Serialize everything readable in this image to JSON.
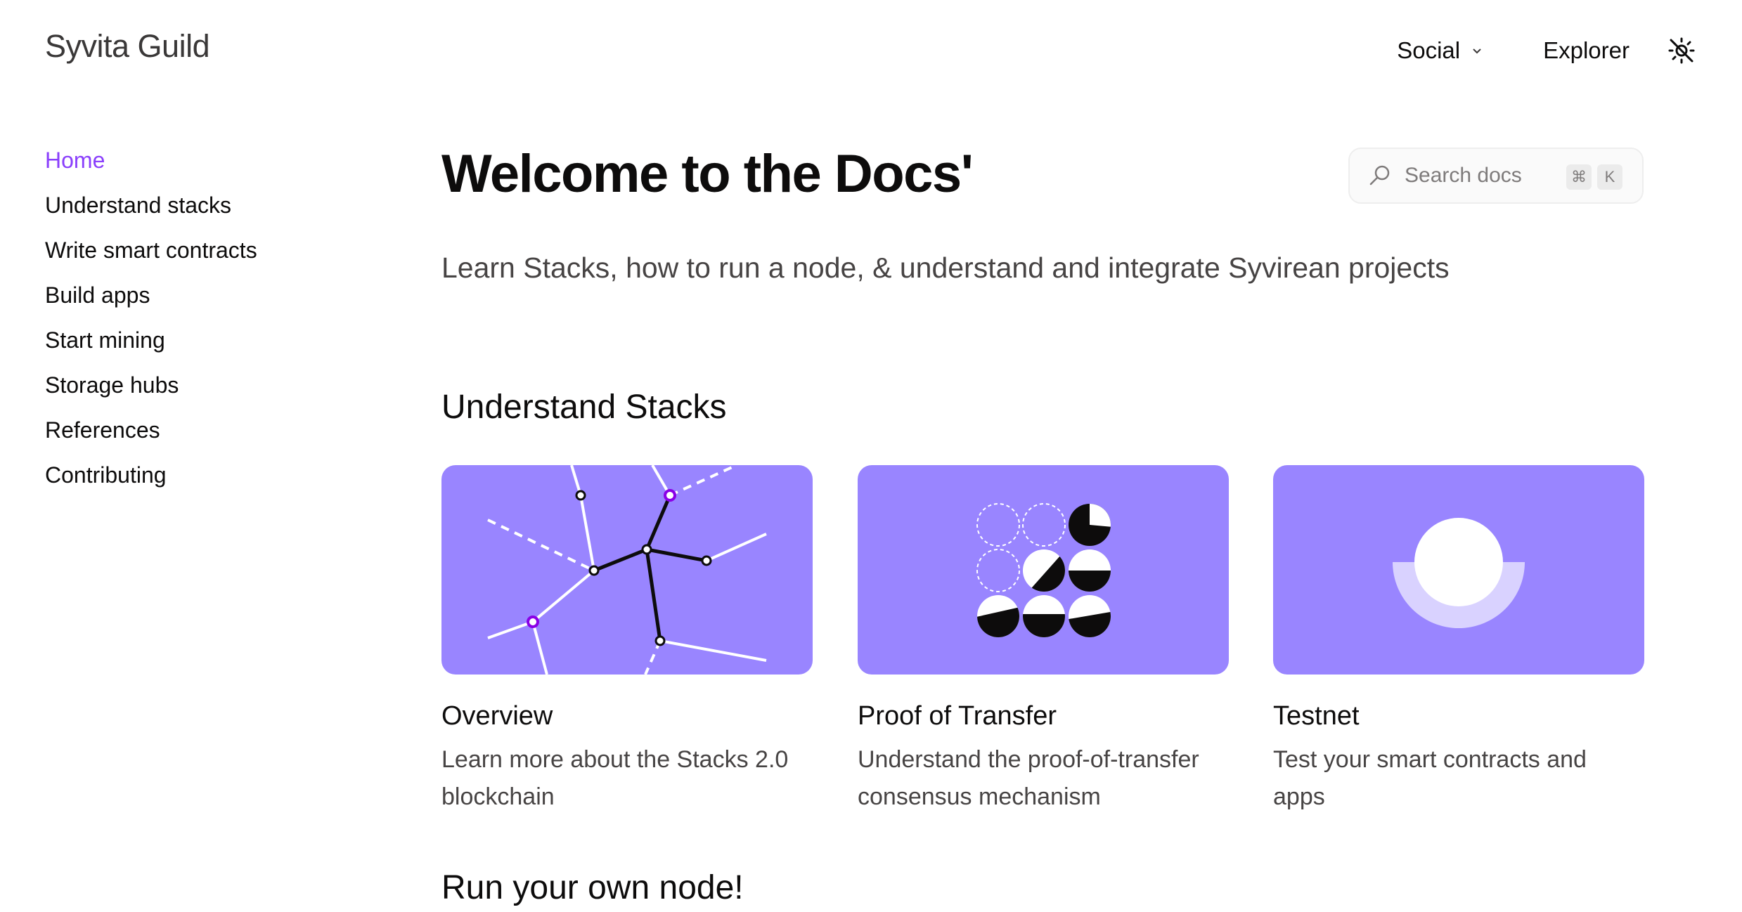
{
  "header": {
    "brand": "Syvita Guild",
    "nav": {
      "social_label": "Social",
      "explorer_label": "Explorer"
    },
    "icons": {
      "social_dropdown": "chevron-down-icon",
      "theme_toggle": "sun-off-icon"
    }
  },
  "sidebar": {
    "items": [
      {
        "label": "Home",
        "active": true
      },
      {
        "label": "Understand stacks"
      },
      {
        "label": "Write smart contracts"
      },
      {
        "label": "Build apps"
      },
      {
        "label": "Start mining"
      },
      {
        "label": "Storage hubs"
      },
      {
        "label": "References"
      },
      {
        "label": "Contributing"
      }
    ]
  },
  "main": {
    "title": "Welcome to the Docs'",
    "subtitle": "Learn Stacks, how to run a node, & understand and integrate Syvirean projects",
    "search": {
      "placeholder": "Search docs",
      "shortcut": [
        "⌘",
        "K"
      ],
      "icon": "search-icon"
    },
    "sections": [
      {
        "title": "Understand Stacks",
        "cards": [
          {
            "title": "Overview",
            "description": "Learn more about the Stacks 2.0 blockchain",
            "illustration": "network-graph"
          },
          {
            "title": "Proof of Transfer",
            "description": "Understand the proof-of-transfer consensus mechanism",
            "illustration": "circle-grid"
          },
          {
            "title": "Testnet",
            "description": "Test your smart contracts and apps",
            "illustration": "half-ring"
          }
        ]
      },
      {
        "title": "Run your own node!"
      }
    ]
  },
  "colors": {
    "accent": "#8a3ffc",
    "card_background": "#9985ff",
    "text": "#0d0c0c",
    "muted_text": "#474444"
  }
}
